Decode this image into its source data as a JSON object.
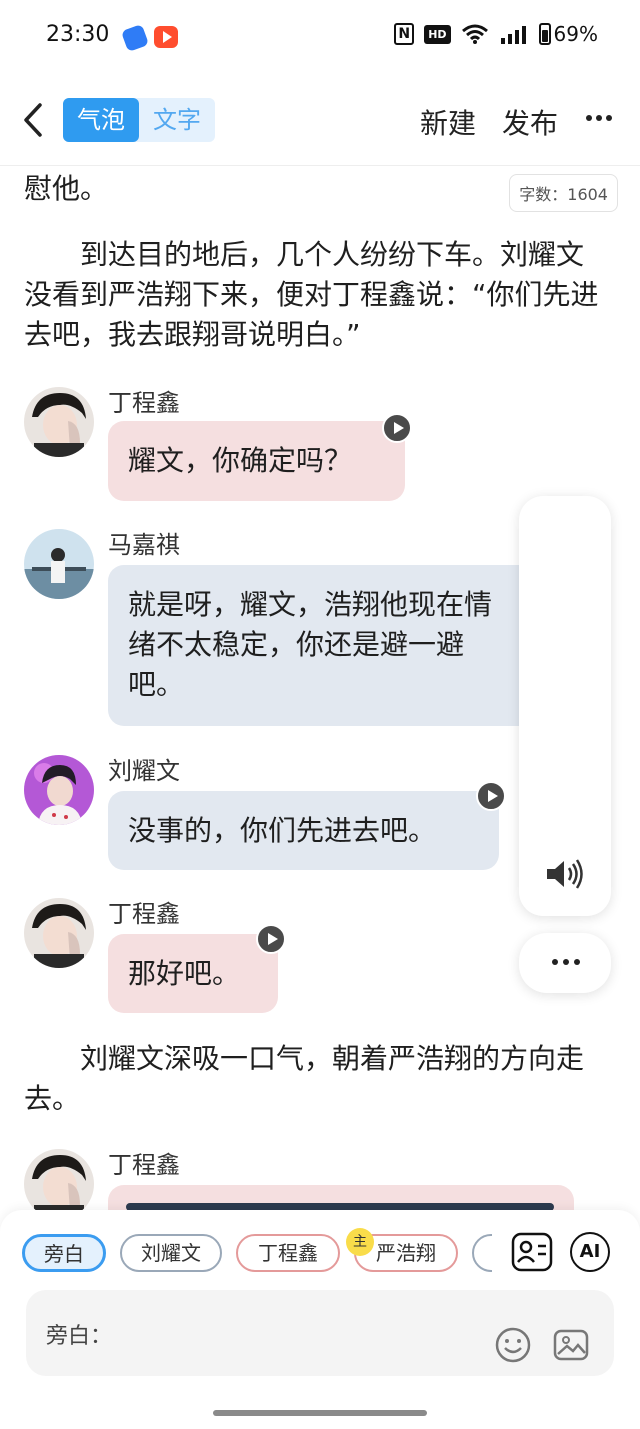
{
  "status_bar": {
    "time": "23:30",
    "battery": "69%",
    "app_icons": [
      "blue-app-icon",
      "video-app-icon"
    ],
    "icons": [
      "nfc-icon",
      "hd-icon",
      "wifi-icon",
      "signal-icon",
      "battery-icon"
    ]
  },
  "header": {
    "tab_bubble": "气泡",
    "tab_text": "文字",
    "new_label": "新建",
    "publish_label": "发布"
  },
  "content": {
    "word_count": "字数：1604",
    "narration_1": "慰他。",
    "narration_2": "　　到达目的地后，几个人纷纷下车。刘耀文没看到严浩翔下来，便对丁程鑫说：“你们先进去吧，我去跟翔哥说明白。”",
    "messages": [
      {
        "speaker": "丁程鑫",
        "text": "耀文，你确定吗？",
        "style": "pink"
      },
      {
        "speaker": "马嘉祺",
        "text": "就是呀，耀文，浩翔他现在情绪不太稳定，你还是避一避吧。",
        "style": "blue"
      },
      {
        "speaker": "刘耀文",
        "text": "没事的，你们先进去吧。",
        "style": "blue"
      },
      {
        "speaker": "丁程鑫",
        "text": "那好吧。",
        "style": "pink"
      },
      {
        "speaker": "丁程鑫",
        "text": "",
        "style": "pink"
      }
    ],
    "narration_3": "　　刘耀文深吸一口气，朝着严浩翔的方向走去。"
  },
  "composer": {
    "chips": [
      "旁白",
      "刘耀文",
      "丁程鑫",
      "严浩翔"
    ],
    "main_badge": "主",
    "ai_label": "AI",
    "input_label": "旁白："
  },
  "colors": {
    "accent": "#2f9bf0",
    "bubble_pink": "#f5dfe0",
    "bubble_blue": "#e2e8f0"
  }
}
